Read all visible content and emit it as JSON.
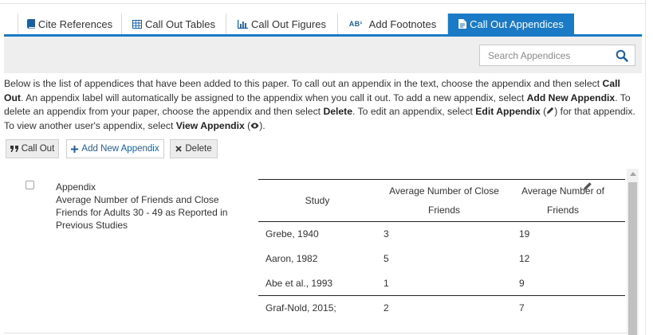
{
  "tabs": [
    {
      "label": "Cite References",
      "icon": "book-icon"
    },
    {
      "label": "Call Out Tables",
      "icon": "table-icon"
    },
    {
      "label": "Call Out Figures",
      "icon": "bar-chart-icon"
    },
    {
      "label": "Add Footnotes",
      "icon": "footnote-icon",
      "badge": "AB¹"
    },
    {
      "label": "Call Out Appendices",
      "icon": "document-icon"
    }
  ],
  "search": {
    "placeholder": "Search Appendices"
  },
  "description": {
    "s1": "Below is the list of appendices that have been added to this paper. To call out an appendix in the text, choose the appendix and then select ",
    "b1": "Call Out",
    "s2": ". An appendix label will automatically be assigned to the appendix when you call it out. To add a new appendix, select ",
    "b2": "Add New Appendix",
    "s3": ". To delete an appendix from your paper, choose the appendix and then select ",
    "b3": "Delete",
    "s4": ". To edit an appendix, select ",
    "b4": "Edit Appendix",
    "s5": " for that appendix. To view another user's appendix, select ",
    "b5": "View Appendix",
    "s6": "."
  },
  "buttons": {
    "call_out": "Call Out",
    "add_new": "Add New Appendix",
    "delete": "Delete"
  },
  "appendix": {
    "label": "Appendix",
    "title": "Average Number of Friends and Close Friends for Adults 30 - 49 as Reported in Previous Studies",
    "table": {
      "headers": [
        "Study",
        "Average Number of Close Friends",
        "Average Number of Friends"
      ],
      "rows": [
        [
          "Grebe, 1940",
          "3",
          "19"
        ],
        [
          "Aaron, 1982",
          "5",
          "12"
        ],
        [
          "Abe et al., 1993",
          "1",
          "9"
        ],
        [
          "Graf-Nold, 2015;",
          "2",
          "7"
        ]
      ]
    }
  },
  "colors": {
    "accent": "#1a7ac6",
    "panel": "#eeeeee"
  }
}
